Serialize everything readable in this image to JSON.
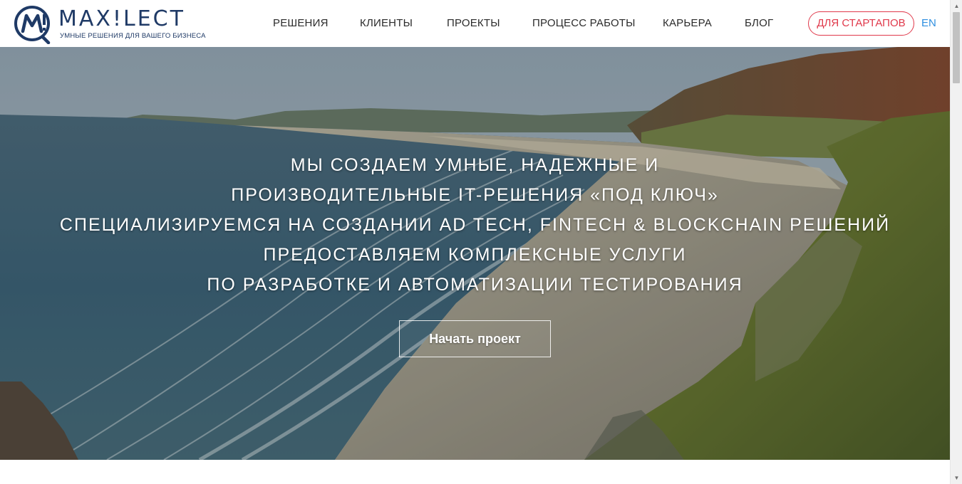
{
  "brand": {
    "name": "MAX!LECT",
    "tagline": "УМНЫЕ РЕШЕНИЯ ДЛЯ ВАШЕГО БИЗНЕСА",
    "color": "#1f3a66"
  },
  "nav": {
    "items": [
      {
        "label": "РЕШЕНИЯ"
      },
      {
        "label": "КЛИЕНТЫ"
      },
      {
        "label": "ПРОЕКТЫ"
      },
      {
        "label": "ПРОЦЕСС РАБОТЫ"
      },
      {
        "label": "КАРЬЕРА"
      },
      {
        "label": "БЛОГ"
      }
    ],
    "startup_label": "ДЛЯ СТАРТАПОВ",
    "lang_label": "EN",
    "accent": "#e0394b",
    "lang_color": "#2f8fe0"
  },
  "hero": {
    "lines": [
      "МЫ СОЗДАЕМ УМНЫЕ, НАДЕЖНЫЕ И",
      "ПРОИЗВОДИТЕЛЬНЫЕ IT-РЕШЕНИЯ «ПОД КЛЮЧ»",
      "СПЕЦИАЛИЗИРУЕМСЯ НА СОЗДАНИИ AD TECH, FINTECH & BLOCKCHAIN РЕШЕНИЙ",
      "ПРЕДОСТАВЛЯЕМ КОМПЛЕКСНЫЕ УСЛУГИ",
      "ПО РАЗРАБОТКЕ И АВТОМАТИЗАЦИИ ТЕСТИРОВАНИЯ"
    ],
    "cta_label": "Начать проект"
  }
}
